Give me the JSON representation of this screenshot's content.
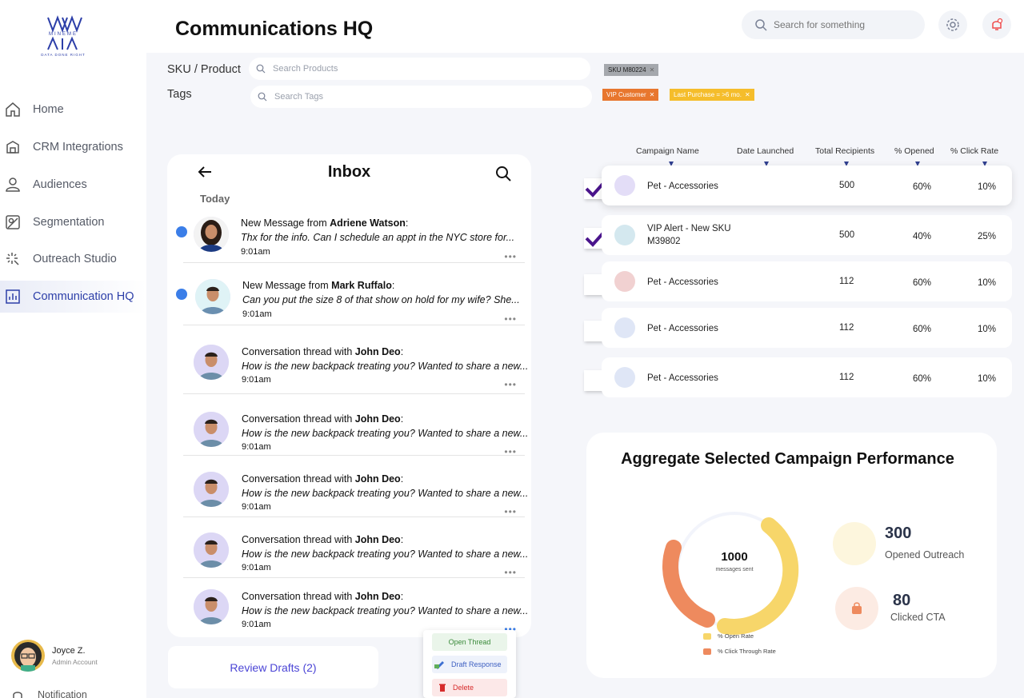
{
  "brand": {
    "logo_text": "MINEME",
    "tagline": "DATA DONE RIGHT"
  },
  "sidebar": {
    "items": [
      {
        "label": "Home",
        "icon": "home-icon"
      },
      {
        "label": "CRM Integrations",
        "icon": "crm-icon"
      },
      {
        "label": "Audiences",
        "icon": "user-icon"
      },
      {
        "label": "Segmentation",
        "icon": "segmentation-icon"
      },
      {
        "label": "Outreach  Studio",
        "icon": "sparkle-icon"
      },
      {
        "label": "Communication HQ",
        "icon": "chart-icon",
        "active": true
      }
    ],
    "user": {
      "name": "Joyce Z.",
      "role": "Admin Account"
    },
    "notification_label": "Notification"
  },
  "header": {
    "title": "Communications HQ",
    "search_placeholder": "Search for something"
  },
  "filters": {
    "sku_label": "SKU / Product",
    "sku_placeholder": "Search Products",
    "tags_label": "Tags",
    "tags_placeholder": "Search Tags",
    "sku_chips": [
      "SKU M80224"
    ],
    "tag_chips": [
      "VIP Customer",
      "Last Purchase = >6 mo."
    ]
  },
  "inbox": {
    "title": "Inbox",
    "section": "Today",
    "messages": [
      {
        "prefix": "New Message from ",
        "name": "Adriene Watson",
        "suffix": ":",
        "preview": "Thx for the info. Can I schedule an appt in the NYC store for...",
        "time": "9:01am",
        "unread": true
      },
      {
        "prefix": "New Message from ",
        "name": "Mark Ruffalo",
        "suffix": ":",
        "preview": "Can you put the size 8 of that show on hold for my wife? She...",
        "time": "9:01am",
        "unread": true
      },
      {
        "prefix": "Conversation thread with ",
        "name": "John Deo",
        "suffix": ":",
        "preview": "How is the new backpack treating you? Wanted to share a new...",
        "time": "9:01am",
        "unread": false
      },
      {
        "prefix": "Conversation thread with ",
        "name": "John Deo",
        "suffix": ":",
        "preview": "How is the new backpack treating you? Wanted to share a new...",
        "time": "9:01am",
        "unread": false
      },
      {
        "prefix": "Conversation thread with ",
        "name": "John Deo",
        "suffix": ":",
        "preview": "How is the new backpack treating you? Wanted to share a new...",
        "time": "9:01am",
        "unread": false
      },
      {
        "prefix": "Conversation thread with ",
        "name": "John Deo",
        "suffix": ":",
        "preview": "How is the new backpack treating you? Wanted to share a new...",
        "time": "9:01am",
        "unread": false
      },
      {
        "prefix": "Conversation thread with ",
        "name": "John Deo",
        "suffix": ":",
        "preview": "How is the new backpack treating you? Wanted to share a new...",
        "time": "9:01am",
        "unread": false
      }
    ],
    "more_glyph": "•••"
  },
  "review_drafts_label": "Review Drafts (2)",
  "context_menu": {
    "open": "Open Thread",
    "draft": "Draft Response",
    "delete": "Delete"
  },
  "campaigns": {
    "headers": [
      "Campaign Name",
      "Date Launched",
      "Total Recipients",
      "% Opened",
      "% Click Rate"
    ],
    "rows": [
      {
        "name": "Pet - Accessories",
        "recipients": "500",
        "opened": "60%",
        "click": "10%",
        "checked": true,
        "color": "#e3ddf7"
      },
      {
        "name": "VIP Alert - New SKU M39802",
        "recipients": "500",
        "opened": "40%",
        "click": "25%",
        "checked": true,
        "color": "#d4e8ef"
      },
      {
        "name": "Pet - Accessories",
        "recipients": "112",
        "opened": "60%",
        "click": "10%",
        "checked": false,
        "color": "#f1d1d1"
      },
      {
        "name": "Pet - Accessories",
        "recipients": "112",
        "opened": "60%",
        "click": "10%",
        "checked": false,
        "color": "#dfe6f6"
      },
      {
        "name": "Pet - Accessories",
        "recipients": "112",
        "opened": "60%",
        "click": "10%",
        "checked": false,
        "color": "#dfe6f6"
      }
    ]
  },
  "performance": {
    "title": "Aggregate Selected Campaign Performance",
    "center_value": "1000",
    "center_label": "messages sent",
    "legend": [
      {
        "label": "% Open Rate",
        "color": "#f7d66a"
      },
      {
        "label": "% Click Through Rate",
        "color": "#ee8a5e"
      }
    ],
    "stats": [
      {
        "value": "300",
        "label": "Opened Outreach"
      },
      {
        "value": "80",
        "label": "Clicked CTA"
      }
    ]
  },
  "colors": {
    "accent": "#2c3ea8",
    "unread_dot": "#3b7ee8",
    "check": "#4a148c"
  }
}
